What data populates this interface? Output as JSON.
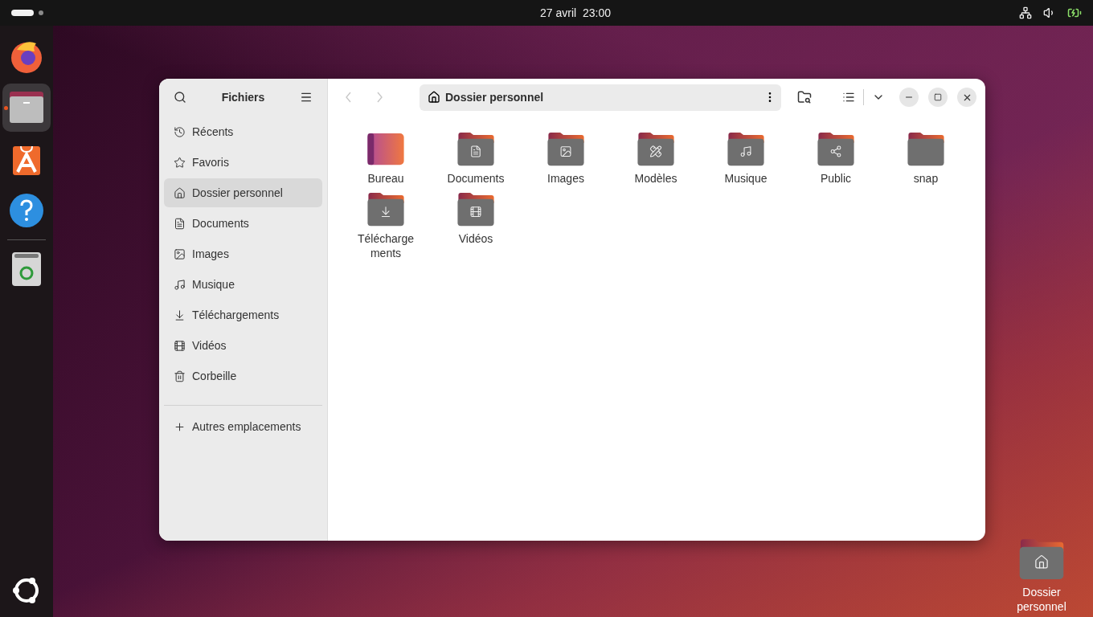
{
  "top_bar": {
    "clock": "27 avril  23:00"
  },
  "dock": {
    "items": [
      {
        "kind": "firefox",
        "selected": false
      },
      {
        "kind": "files",
        "selected": true
      },
      {
        "kind": "appcenter",
        "selected": false
      },
      {
        "kind": "help",
        "selected": false
      },
      {
        "kind": "trash",
        "selected": false
      }
    ]
  },
  "window": {
    "sidebar": {
      "title": "Fichiers",
      "items": [
        {
          "kind": "recent",
          "label": "Récents",
          "selected": false
        },
        {
          "kind": "star",
          "label": "Favoris",
          "selected": false
        },
        {
          "kind": "home",
          "label": "Dossier personnel",
          "selected": true
        },
        {
          "kind": "document",
          "label": "Documents",
          "selected": false
        },
        {
          "kind": "image",
          "label": "Images",
          "selected": false
        },
        {
          "kind": "music",
          "label": "Musique",
          "selected": false
        },
        {
          "kind": "download",
          "label": "Téléchargements",
          "selected": false
        },
        {
          "kind": "video",
          "label": "Vidéos",
          "selected": false
        },
        {
          "kind": "trash",
          "label": "Corbeille",
          "selected": false
        }
      ],
      "other_locations": "Autres emplacements"
    },
    "nav_buttons": [
      {
        "kind": "back",
        "disabled": true
      },
      {
        "kind": "forward",
        "disabled": true
      }
    ],
    "path_bar": {
      "location": "Dossier personnel"
    },
    "folders": [
      {
        "kind": "desktop",
        "label": "Bureau"
      },
      {
        "kind": "document",
        "label": "Documents"
      },
      {
        "kind": "image",
        "label": "Images"
      },
      {
        "kind": "template",
        "label": "Modèles"
      },
      {
        "kind": "music",
        "label": "Musique"
      },
      {
        "kind": "share",
        "label": "Public"
      },
      {
        "kind": "plain",
        "label": "snap"
      },
      {
        "kind": "download",
        "label": "Télécharge ments"
      },
      {
        "kind": "video",
        "label": "Vidéos"
      }
    ]
  },
  "desktop_icons": [
    {
      "kind": "home",
      "label": "Dossier personnel"
    }
  ]
}
